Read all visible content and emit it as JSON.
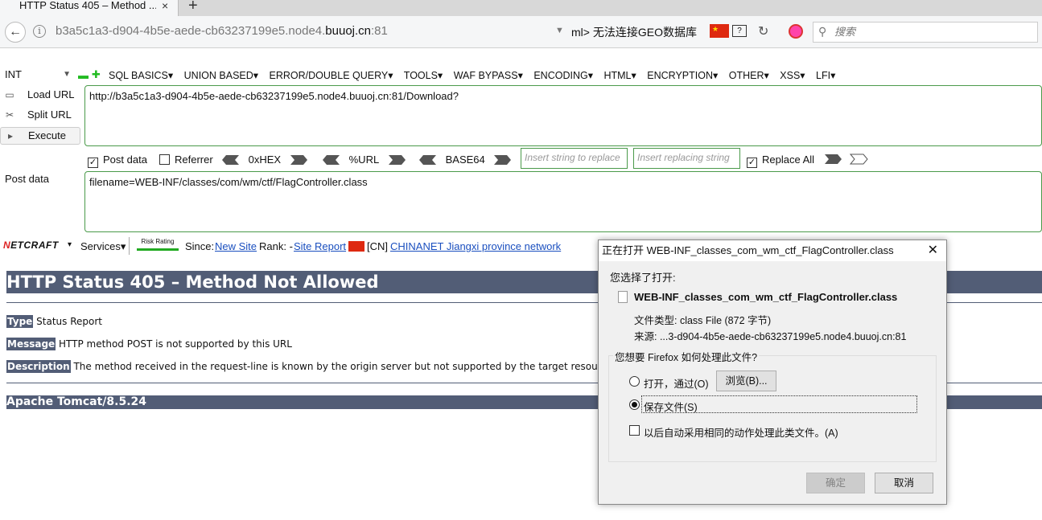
{
  "tab": {
    "title": "HTTP Status 405 – Method ...",
    "close": "×",
    "new": "+"
  },
  "nav": {
    "url_prefix": "b3a5c1a3-d904-4b5e-aede-cb63237199e5.node4.",
    "url_domain": "buuoj.cn",
    "url_suffix": ":81",
    "geo_text": "ml>   无法连接GEO数据库",
    "help": "?",
    "search_placeholder": "搜索"
  },
  "hackbar": {
    "select": "INT",
    "menu": [
      "SQL BASICS▾",
      "UNION BASED▾",
      "ERROR/DOUBLE QUERY▾",
      "TOOLS▾",
      "WAF BYPASS▾",
      "ENCODING▾",
      "HTML▾",
      "ENCRYPTION▾",
      "OTHER▾",
      "XSS▾",
      "LFI▾"
    ],
    "load_url": "Load URL",
    "split_url": "Split URL",
    "execute": "Execute",
    "url_value": "http://b3a5c1a3-d904-4b5e-aede-cb63237199e5.node4.buuoj.cn:81/Download?",
    "post_data_cb": "Post data",
    "referrer_cb": "Referrer",
    "hex": "0xHEX",
    "url_enc": "%URL",
    "base64": "BASE64",
    "insert_replace_ph": "Insert string to replace",
    "insert_replacing_ph": "Insert replacing string",
    "replace_all": "Replace All",
    "post_label": "Post data",
    "post_value": "filename=WEB-INF/classes/com/wm/ctf/FlagController.class"
  },
  "netcraft": {
    "services": "Services▾",
    "risk": "Risk Rating",
    "since": "Since:",
    "new_site": "New Site",
    "rank": "Rank: -",
    "site_report": "Site Report",
    "cn": "[CN]",
    "network": "CHINANET Jiangxi province network"
  },
  "page": {
    "heading": "HTTP Status 405 – Method Not Allowed",
    "type_k": "Type",
    "type_v": "Status Report",
    "message_k": "Message",
    "message_v": "HTTP method POST is not supported by this URL",
    "desc_k": "Description",
    "desc_v": "The method received in the request-line is known by the origin server but not supported by the target resource.",
    "footer": "Apache Tomcat/8.5.24"
  },
  "dialog": {
    "title": "正在打开 WEB-INF_classes_com_wm_ctf_FlagController.class",
    "chosen": "您选择了打开:",
    "file_name": "WEB-INF_classes_com_wm_ctf_FlagController.class",
    "file_type": "文件类型:   class File (872 字节)",
    "file_src": "来源:    ...3-d904-4b5e-aede-cb63237199e5.node4.buuoj.cn:81",
    "question": "您想要 Firefox 如何处理此文件?",
    "open_with": "打开，通过(O)",
    "browse": "浏览(B)...",
    "save_file": "保存文件(S)",
    "auto": "以后自动采用相同的动作处理此类文件。(A)",
    "ok": "确定",
    "cancel": "取消",
    "selected_option": "save"
  }
}
